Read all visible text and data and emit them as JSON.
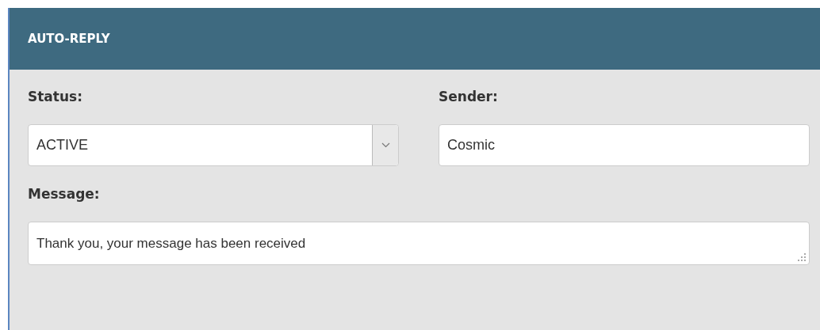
{
  "panel": {
    "title": "AUTO-REPLY"
  },
  "status": {
    "label": "Status:",
    "value": "ACTIVE"
  },
  "sender": {
    "label": "Sender:",
    "value": "Cosmic"
  },
  "message": {
    "label": "Message:",
    "value": "Thank you, your message has been received"
  }
}
